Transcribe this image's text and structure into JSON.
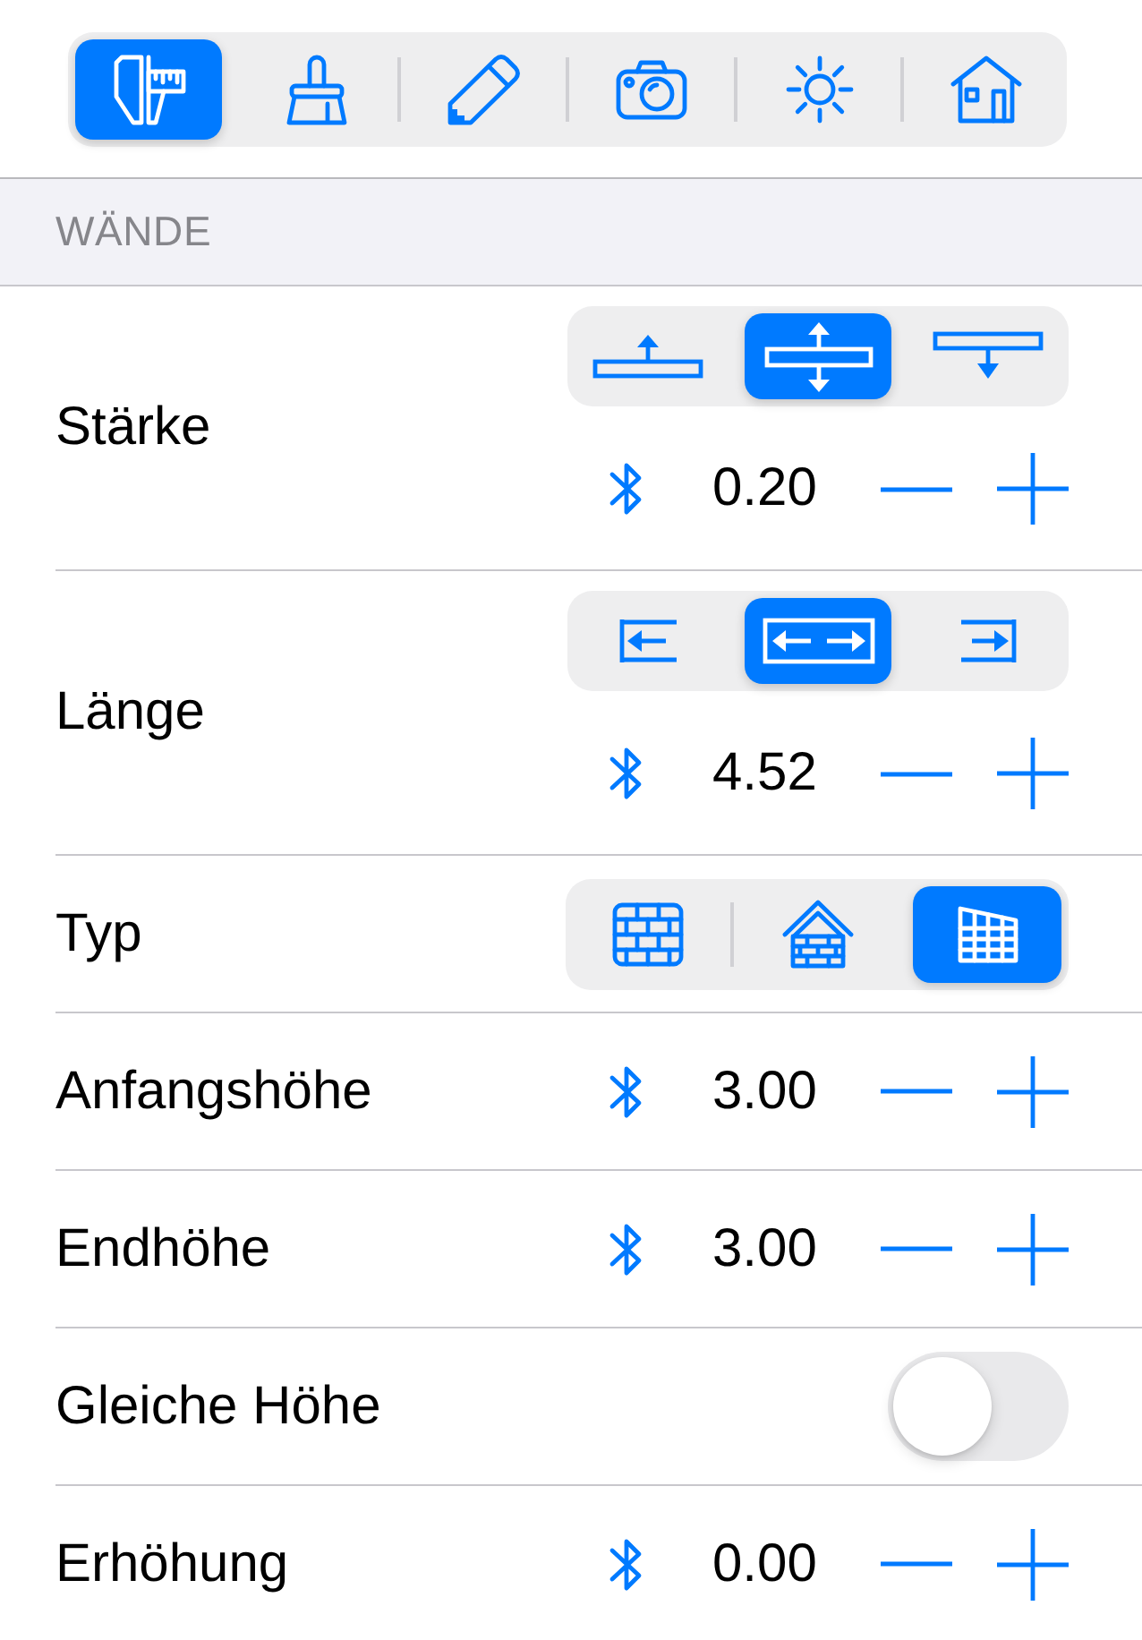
{
  "toolbar": {
    "tabs": [
      {
        "selected": true
      },
      {
        "selected": false
      },
      {
        "selected": false
      },
      {
        "selected": false
      },
      {
        "selected": false
      },
      {
        "selected": false
      }
    ]
  },
  "section": {
    "title": "WÄNDE"
  },
  "rows": [
    {
      "kind": "segmented_stepper",
      "label": "Stärke",
      "options": [
        {
          "selected": false
        },
        {
          "selected": true
        },
        {
          "selected": false
        }
      ],
      "value": "0.20"
    },
    {
      "kind": "segmented_stepper",
      "label": "Länge",
      "options": [
        {
          "selected": false
        },
        {
          "selected": true
        },
        {
          "selected": false
        }
      ],
      "value": "4.52"
    },
    {
      "kind": "segmented",
      "label": "Typ",
      "options": [
        {
          "selected": false
        },
        {
          "selected": false
        },
        {
          "selected": true
        }
      ]
    },
    {
      "kind": "stepper",
      "label": "Anfangshöhe",
      "value": "3.00"
    },
    {
      "kind": "stepper",
      "label": "Endhöhe",
      "value": "3.00"
    },
    {
      "kind": "toggle",
      "label": "Gleiche Höhe",
      "on": false
    },
    {
      "kind": "stepper",
      "label": "Erhöhung",
      "value": "0.00"
    }
  ]
}
